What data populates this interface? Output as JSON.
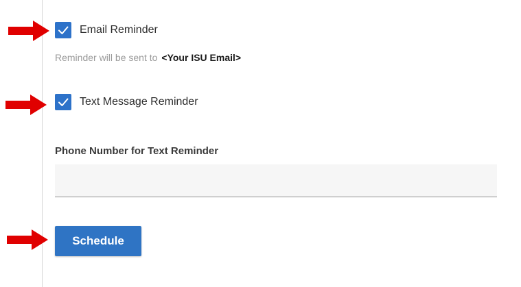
{
  "reminders": {
    "email": {
      "label": "Email Reminder",
      "checked": true,
      "hint_text": "Reminder will be sent to",
      "hint_email": "<Your ISU Email>"
    },
    "text": {
      "label": "Text Message Reminder",
      "checked": true
    }
  },
  "phone": {
    "label": "Phone Number for Text Reminder",
    "value": "",
    "placeholder": ""
  },
  "actions": {
    "schedule_label": "Schedule"
  },
  "colors": {
    "accent": "#2f74c4",
    "arrow": "#e00000",
    "checkbox": "#2d72c9"
  },
  "icons": {
    "arrow": "right-arrow-icon",
    "check": "checkmark-icon"
  }
}
